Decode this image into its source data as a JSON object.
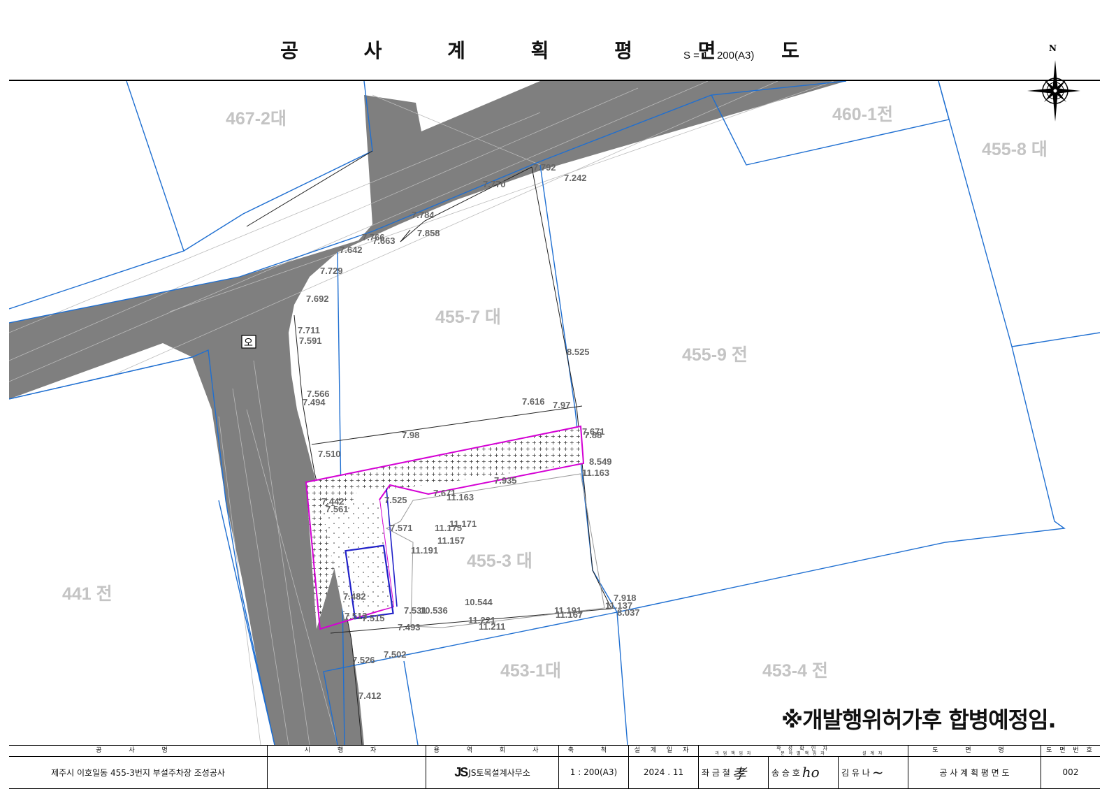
{
  "title": "공 사 계 획 평 면 도",
  "scale_text": "S = 1 : 200(A3)",
  "compass_label": "N",
  "note": "※개발행위허가후 합병예정임.",
  "parcels": [
    "467-2대",
    "460-1전",
    "455-8 대",
    "455-7 대",
    "455-9 전",
    "441 전",
    "455-3 대",
    "453-1대",
    "453-4 전"
  ],
  "elevations": [
    "7.792",
    "7.242",
    "7.770",
    "7.784",
    "7.766",
    "7.663",
    "7.858",
    "7.642",
    "7.729",
    "7.692",
    "7.711",
    "7.591",
    "8.525",
    "7.566",
    "7.494",
    "7.616",
    "7.97",
    "7.98",
    "7.671",
    "7.88",
    "7.510",
    "8.549",
    "11.163",
    "7.935",
    "7.442",
    "7.561",
    "7.525",
    "7.671",
    "11.163",
    "7.571",
    "11.171",
    "11.175",
    "11.157",
    "11.191",
    "7.482",
    "10.544",
    "7.513",
    "7.515",
    "7.531",
    "10.536",
    "11.221",
    "11.211",
    "11.191",
    "11.167",
    "11.137",
    "7.918",
    "8.037",
    "7.493",
    "7.526",
    "7.502",
    "7.412"
  ],
  "facility_label": "오",
  "title_block": {
    "headers": [
      "공 사 명",
      "시 행 자",
      "용 역 회 사",
      "축 척",
      "설 계 일 자",
      "작 성 확 인 자",
      "도 면 명",
      "도 면 번 호"
    ],
    "sub_headers": [
      "과 업 책 임 자",
      "분 야 별 책 임 자",
      "설 계 자"
    ],
    "project_name": "제주시 이호일동 455-3번지 부설주차장 조성공사",
    "executor": "",
    "company_logo": "JS",
    "company": "JS토목설계사무소",
    "scale": "1 : 200(A3)",
    "date": "2024 . 11",
    "persons": [
      "좌 금 철",
      "송 승 호",
      "김 유 나"
    ],
    "drawing_name": "공 사 계 획 평 면 도",
    "drawing_no": "002"
  },
  "colors": {
    "road": "#808080",
    "boundary": "#1f6fd1",
    "site": "#d400d4",
    "building": "#2020c8"
  }
}
